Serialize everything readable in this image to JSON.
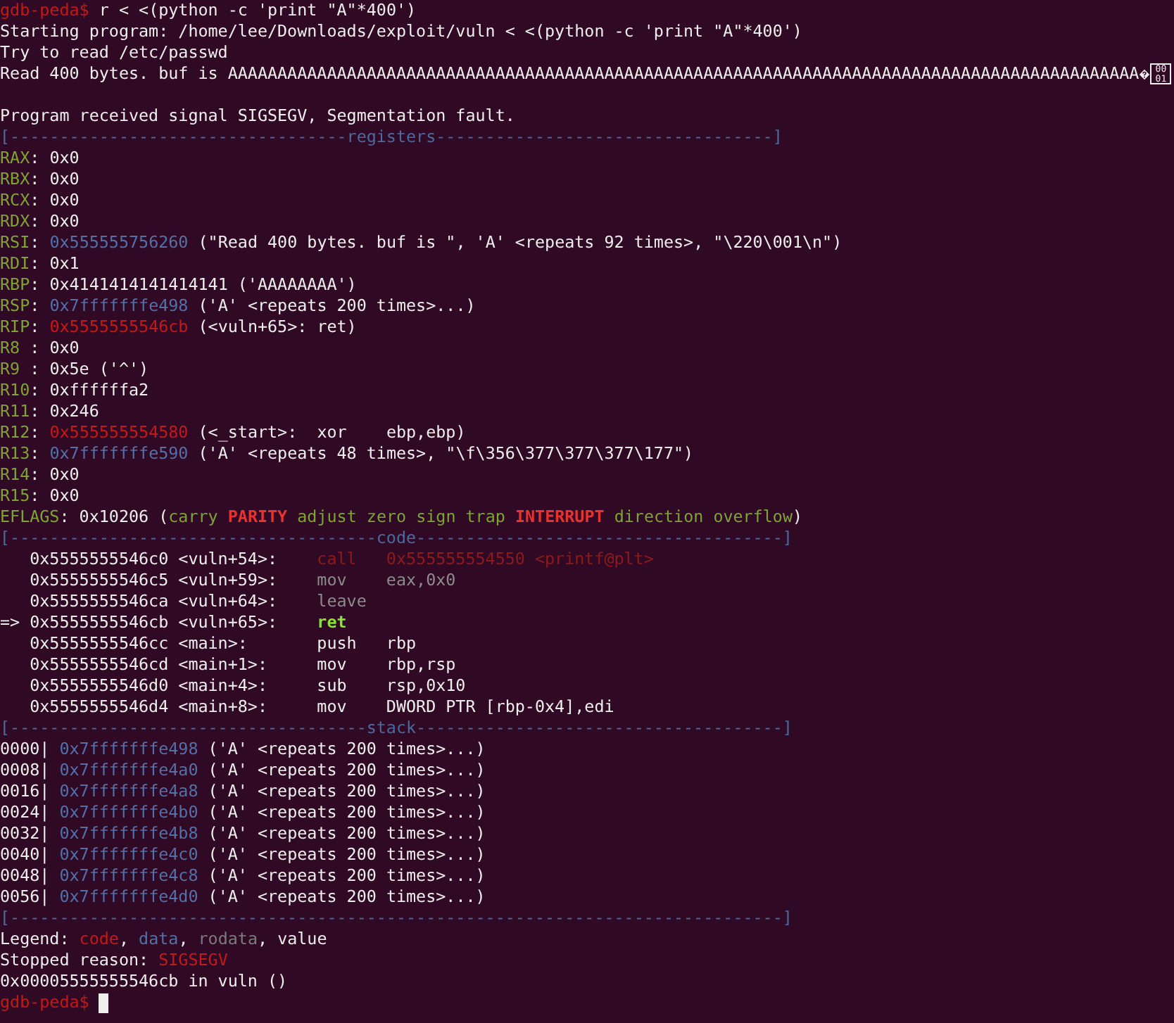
{
  "terminal": {
    "lines": [
      {
        "segments": [
          {
            "text": "gdb-peda$",
            "kind": "prompt"
          },
          {
            "text": " r < <(python -c 'print \"A\"*400')",
            "kind": "plain"
          }
        ]
      },
      {
        "segments": [
          {
            "text": "Starting program: /home/lee/Downloads/exploit/vuln < <(python -c 'print \"A\"*400')",
            "kind": "plain"
          }
        ]
      },
      {
        "segments": [
          {
            "text": "Try to read /etc/passwd",
            "kind": "plain"
          }
        ]
      },
      {
        "segments": [
          {
            "text": "Read 400 bytes. buf is AAAAAAAAAAAAAAAAAAAAAAAAAAAAAAAAAAAAAAAAAAAAAAAAAAAAAAAAAAAAAAAAAAAAAAAAAAAAAAAAAAAAAAAAAAAA",
            "kind": "plain"
          },
          {
            "kind": "glyph"
          },
          {
            "text": "00 01",
            "kind": "hexbox"
          }
        ]
      },
      {
        "gap_before": true,
        "segments": [
          {
            "text": "Program received signal SIGSEGV, Segmentation fault.",
            "kind": "plain"
          }
        ]
      },
      {
        "segments": [
          {
            "text": "[----------------------------------registers----------------------------------]",
            "kind": "rule"
          }
        ]
      },
      {
        "segments": [
          {
            "text": "RAX",
            "kind": "reg"
          },
          {
            "text": ": 0x0",
            "kind": "plain"
          }
        ]
      },
      {
        "segments": [
          {
            "text": "RBX",
            "kind": "reg"
          },
          {
            "text": ": 0x0",
            "kind": "plain"
          }
        ]
      },
      {
        "segments": [
          {
            "text": "RCX",
            "kind": "reg"
          },
          {
            "text": ": 0x0",
            "kind": "plain"
          }
        ]
      },
      {
        "segments": [
          {
            "text": "RDX",
            "kind": "reg"
          },
          {
            "text": ": 0x0",
            "kind": "plain"
          }
        ]
      },
      {
        "segments": [
          {
            "text": "RSI",
            "kind": "reg"
          },
          {
            "text": ": ",
            "kind": "plain"
          },
          {
            "text": "0x555555756260",
            "kind": "data"
          },
          {
            "text": " (\"Read 400 bytes. buf is \", 'A' <repeats 92 times>, \"\\220\\001\\n\")",
            "kind": "plain"
          }
        ]
      },
      {
        "segments": [
          {
            "text": "RDI",
            "kind": "reg"
          },
          {
            "text": ": 0x1",
            "kind": "plain"
          }
        ]
      },
      {
        "segments": [
          {
            "text": "RBP",
            "kind": "reg"
          },
          {
            "text": ": 0x4141414141414141 ('AAAAAAAA')",
            "kind": "plain"
          }
        ]
      },
      {
        "segments": [
          {
            "text": "RSP",
            "kind": "reg"
          },
          {
            "text": ": ",
            "kind": "plain"
          },
          {
            "text": "0x7fffffffe498",
            "kind": "data"
          },
          {
            "text": " ('A' <repeats 200 times>...)",
            "kind": "plain"
          }
        ]
      },
      {
        "segments": [
          {
            "text": "RIP",
            "kind": "reg"
          },
          {
            "text": ": ",
            "kind": "plain"
          },
          {
            "text": "0x5555555546cb",
            "kind": "code"
          },
          {
            "text": " (<vuln+65>: ret)",
            "kind": "plain"
          }
        ]
      },
      {
        "segments": [
          {
            "text": "R8",
            "kind": "reg"
          },
          {
            "text": " : 0x0",
            "kind": "plain"
          }
        ]
      },
      {
        "segments": [
          {
            "text": "R9",
            "kind": "reg"
          },
          {
            "text": " : 0x5e ('^')",
            "kind": "plain"
          }
        ]
      },
      {
        "segments": [
          {
            "text": "R10",
            "kind": "reg"
          },
          {
            "text": ": 0xffffffa2",
            "kind": "plain"
          }
        ]
      },
      {
        "segments": [
          {
            "text": "R11",
            "kind": "reg"
          },
          {
            "text": ": 0x246",
            "kind": "plain"
          }
        ]
      },
      {
        "segments": [
          {
            "text": "R12",
            "kind": "reg"
          },
          {
            "text": ": ",
            "kind": "plain"
          },
          {
            "text": "0x555555554580",
            "kind": "code"
          },
          {
            "text": " (<_start>:  xor    ebp,ebp)",
            "kind": "plain"
          }
        ]
      },
      {
        "segments": [
          {
            "text": "R13",
            "kind": "reg"
          },
          {
            "text": ": ",
            "kind": "plain"
          },
          {
            "text": "0x7fffffffe590",
            "kind": "data"
          },
          {
            "text": " ('A' <repeats 48 times>, \"\\f\\356\\377\\377\\377\\177\")",
            "kind": "plain"
          }
        ]
      },
      {
        "segments": [
          {
            "text": "R14",
            "kind": "reg"
          },
          {
            "text": ": 0x0",
            "kind": "plain"
          }
        ]
      },
      {
        "segments": [
          {
            "text": "R15",
            "kind": "reg"
          },
          {
            "text": ": 0x0",
            "kind": "plain"
          }
        ]
      },
      {
        "segments": [
          {
            "text": "EFLAGS",
            "kind": "reg"
          },
          {
            "text": ": 0x10206 (",
            "kind": "plain"
          },
          {
            "text": "carry ",
            "kind": "flag_clear"
          },
          {
            "text": "PARITY",
            "kind": "flag_set"
          },
          {
            "text": " adjust zero sign trap ",
            "kind": "flag_clear"
          },
          {
            "text": "INTERRUPT",
            "kind": "flag_set"
          },
          {
            "text": " direction overflow",
            "kind": "flag_clear"
          },
          {
            "text": ")",
            "kind": "plain"
          }
        ]
      },
      {
        "segments": [
          {
            "text": "[-------------------------------------code-------------------------------------]",
            "kind": "rule"
          }
        ]
      },
      {
        "segments": [
          {
            "text": "   0x5555555546c0 <vuln+54>:    ",
            "kind": "plain"
          },
          {
            "text": "call   0x555555554550 <printf@plt>",
            "kind": "past_call"
          }
        ]
      },
      {
        "segments": [
          {
            "text": "   0x5555555546c5 <vuln+59>:    ",
            "kind": "plain"
          },
          {
            "text": "mov    eax,0x0",
            "kind": "past"
          }
        ]
      },
      {
        "segments": [
          {
            "text": "   0x5555555546ca <vuln+64>:    ",
            "kind": "plain"
          },
          {
            "text": "leave",
            "kind": "past"
          }
        ]
      },
      {
        "segments": [
          {
            "text": "=> 0x5555555546cb <vuln+65>:    ",
            "kind": "plain"
          },
          {
            "text": "ret",
            "kind": "current"
          }
        ]
      },
      {
        "segments": [
          {
            "text": "   0x5555555546cc <main>:       push   rbp",
            "kind": "plain"
          }
        ]
      },
      {
        "segments": [
          {
            "text": "   0x5555555546cd <main+1>:     mov    rbp,rsp",
            "kind": "plain"
          }
        ]
      },
      {
        "segments": [
          {
            "text": "   0x5555555546d0 <main+4>:     sub    rsp,0x10",
            "kind": "plain"
          }
        ]
      },
      {
        "segments": [
          {
            "text": "   0x5555555546d4 <main+8>:     mov    DWORD PTR [rbp-0x4],edi",
            "kind": "plain"
          }
        ]
      },
      {
        "segments": [
          {
            "text": "[------------------------------------stack-------------------------------------]",
            "kind": "rule"
          }
        ]
      },
      {
        "segments": [
          {
            "text": "0000| ",
            "kind": "plain"
          },
          {
            "text": "0x7fffffffe498",
            "kind": "data"
          },
          {
            "text": " ('A' <repeats 200 times>...)",
            "kind": "plain"
          }
        ]
      },
      {
        "segments": [
          {
            "text": "0008| ",
            "kind": "plain"
          },
          {
            "text": "0x7fffffffe4a0",
            "kind": "data"
          },
          {
            "text": " ('A' <repeats 200 times>...)",
            "kind": "plain"
          }
        ]
      },
      {
        "segments": [
          {
            "text": "0016| ",
            "kind": "plain"
          },
          {
            "text": "0x7fffffffe4a8",
            "kind": "data"
          },
          {
            "text": " ('A' <repeats 200 times>...)",
            "kind": "plain"
          }
        ]
      },
      {
        "segments": [
          {
            "text": "0024| ",
            "kind": "plain"
          },
          {
            "text": "0x7fffffffe4b0",
            "kind": "data"
          },
          {
            "text": " ('A' <repeats 200 times>...)",
            "kind": "plain"
          }
        ]
      },
      {
        "segments": [
          {
            "text": "0032| ",
            "kind": "plain"
          },
          {
            "text": "0x7fffffffe4b8",
            "kind": "data"
          },
          {
            "text": " ('A' <repeats 200 times>...)",
            "kind": "plain"
          }
        ]
      },
      {
        "segments": [
          {
            "text": "0040| ",
            "kind": "plain"
          },
          {
            "text": "0x7fffffffe4c0",
            "kind": "data"
          },
          {
            "text": " ('A' <repeats 200 times>...)",
            "kind": "plain"
          }
        ]
      },
      {
        "segments": [
          {
            "text": "0048| ",
            "kind": "plain"
          },
          {
            "text": "0x7fffffffe4c8",
            "kind": "data"
          },
          {
            "text": " ('A' <repeats 200 times>...)",
            "kind": "plain"
          }
        ]
      },
      {
        "segments": [
          {
            "text": "0056| ",
            "kind": "plain"
          },
          {
            "text": "0x7fffffffe4d0",
            "kind": "data"
          },
          {
            "text": " ('A' <repeats 200 times>...)",
            "kind": "plain"
          }
        ]
      },
      {
        "segments": [
          {
            "text": "[------------------------------------------------------------------------------]",
            "kind": "rule"
          }
        ]
      },
      {
        "segments": [
          {
            "text": "Legend: ",
            "kind": "plain"
          },
          {
            "text": "code",
            "kind": "code"
          },
          {
            "text": ", ",
            "kind": "plain"
          },
          {
            "text": "data",
            "kind": "data"
          },
          {
            "text": ", ",
            "kind": "plain"
          },
          {
            "text": "rodata",
            "kind": "rodata"
          },
          {
            "text": ", value",
            "kind": "plain"
          }
        ]
      },
      {
        "segments": [
          {
            "text": "Stopped reason: ",
            "kind": "plain"
          },
          {
            "text": "SIGSEGV",
            "kind": "code"
          }
        ]
      },
      {
        "segments": [
          {
            "text": "0x00005555555546cb in vuln ()",
            "kind": "plain"
          }
        ]
      },
      {
        "segments": [
          {
            "text": "gdb-peda$",
            "kind": "prompt"
          },
          {
            "kind": "cursor"
          }
        ]
      }
    ]
  }
}
